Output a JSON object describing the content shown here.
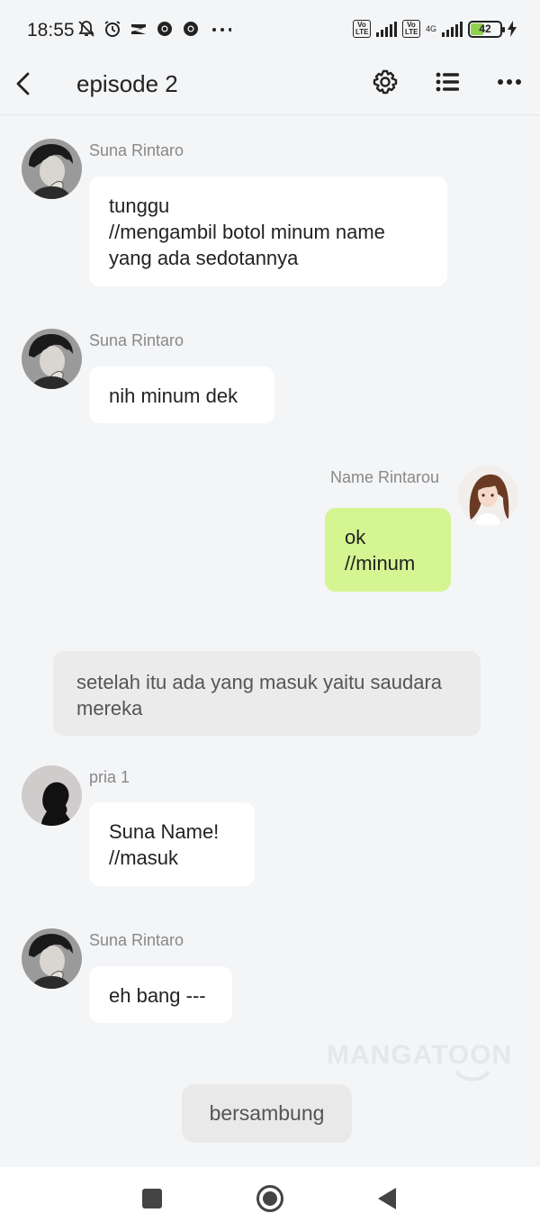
{
  "status_bar": {
    "time": "18:55",
    "left_icons": [
      "bell-off-icon",
      "alarm-icon",
      "capcut-icon",
      "chrome-icon",
      "chrome-icon",
      "more-dots-icon"
    ],
    "volte1": "Vo LTE",
    "volte2": "Vo LTE",
    "network": "4G",
    "battery": "42"
  },
  "header": {
    "title": "episode 2",
    "back_icon": "back-arrow-icon",
    "settings_icon": "gear-icon",
    "list_icon": "list-icon",
    "more_icon": "more-dots-icon"
  },
  "messages": [
    {
      "sender": "Suna Rintaro",
      "text": "tunggu\n//mengambil botol minum name yang ada sedotannya",
      "side": "left"
    },
    {
      "sender": "Suna Rintaro",
      "text": "nih minum dek",
      "side": "left"
    },
    {
      "sender": "Name Rintarou",
      "text": "ok\n//minum",
      "side": "right"
    },
    {
      "sender": "pria 1",
      "text": "Suna Name!\n//masuk",
      "side": "left"
    },
    {
      "sender": "Suna Rintaro",
      "text": "eh bang ---",
      "side": "left"
    }
  ],
  "narration": "setelah itu ada yang masuk yaitu saudara mereka",
  "watermark": "MANGATOON",
  "continue_label": "bersambung",
  "colors": {
    "background": "#f4f5f7",
    "bubble": "#ffffff",
    "bubble_self": "#d4f591",
    "narration": "#ebebec"
  }
}
